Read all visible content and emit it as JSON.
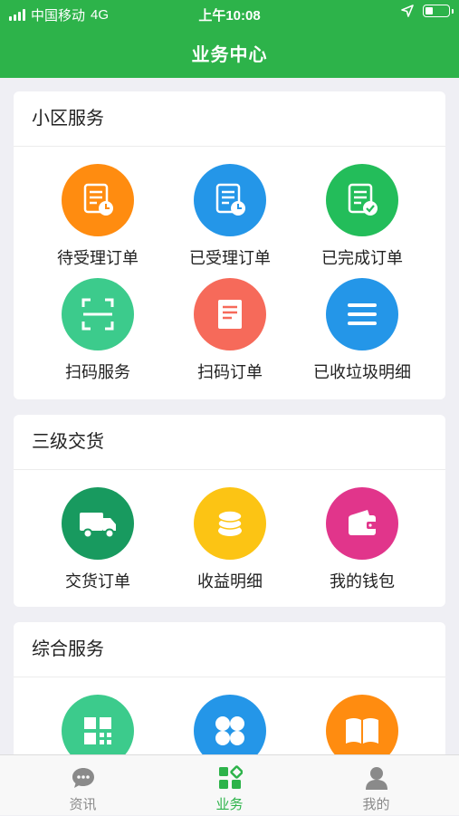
{
  "status_bar": {
    "carrier": "中国移动",
    "network": "4G",
    "time": "上午10:08"
  },
  "nav": {
    "title": "业务中心"
  },
  "sections": [
    {
      "title": "小区服务",
      "items": [
        {
          "label": "待受理订单",
          "icon": "pending-order-icon",
          "color": "#ff8c10"
        },
        {
          "label": "已受理订单",
          "icon": "accepted-order-icon",
          "color": "#2496e8"
        },
        {
          "label": "已完成订单",
          "icon": "completed-order-icon",
          "color": "#23bd5a"
        },
        {
          "label": "扫码服务",
          "icon": "scan-icon",
          "color": "#3ccb8c"
        },
        {
          "label": "扫码订单",
          "icon": "note-icon",
          "color": "#f66a5a"
        },
        {
          "label": "已收垃圾明细",
          "icon": "list-icon",
          "color": "#2496e8"
        }
      ]
    },
    {
      "title": "三级交货",
      "items": [
        {
          "label": "交货订单",
          "icon": "truck-icon",
          "color": "#189a5f"
        },
        {
          "label": "收益明细",
          "icon": "coins-icon",
          "color": "#fcc414"
        },
        {
          "label": "我的钱包",
          "icon": "wallet-icon",
          "color": "#e1358b"
        }
      ]
    },
    {
      "title": "综合服务",
      "items": [
        {
          "label": "",
          "icon": "qrcode-icon",
          "color": "#3ccb8c"
        },
        {
          "label": "",
          "icon": "clover-icon",
          "color": "#2496e8"
        },
        {
          "label": "",
          "icon": "book-icon",
          "color": "#ff8c10"
        }
      ]
    }
  ],
  "tabs": [
    {
      "label": "资讯",
      "icon": "chat-icon",
      "active": false
    },
    {
      "label": "业务",
      "icon": "grid-icon",
      "active": true
    },
    {
      "label": "我的",
      "icon": "person-icon",
      "active": false
    }
  ],
  "colors": {
    "primary": "#2db34a",
    "background": "#efeff4",
    "tab_inactive": "#8a8a8a"
  }
}
